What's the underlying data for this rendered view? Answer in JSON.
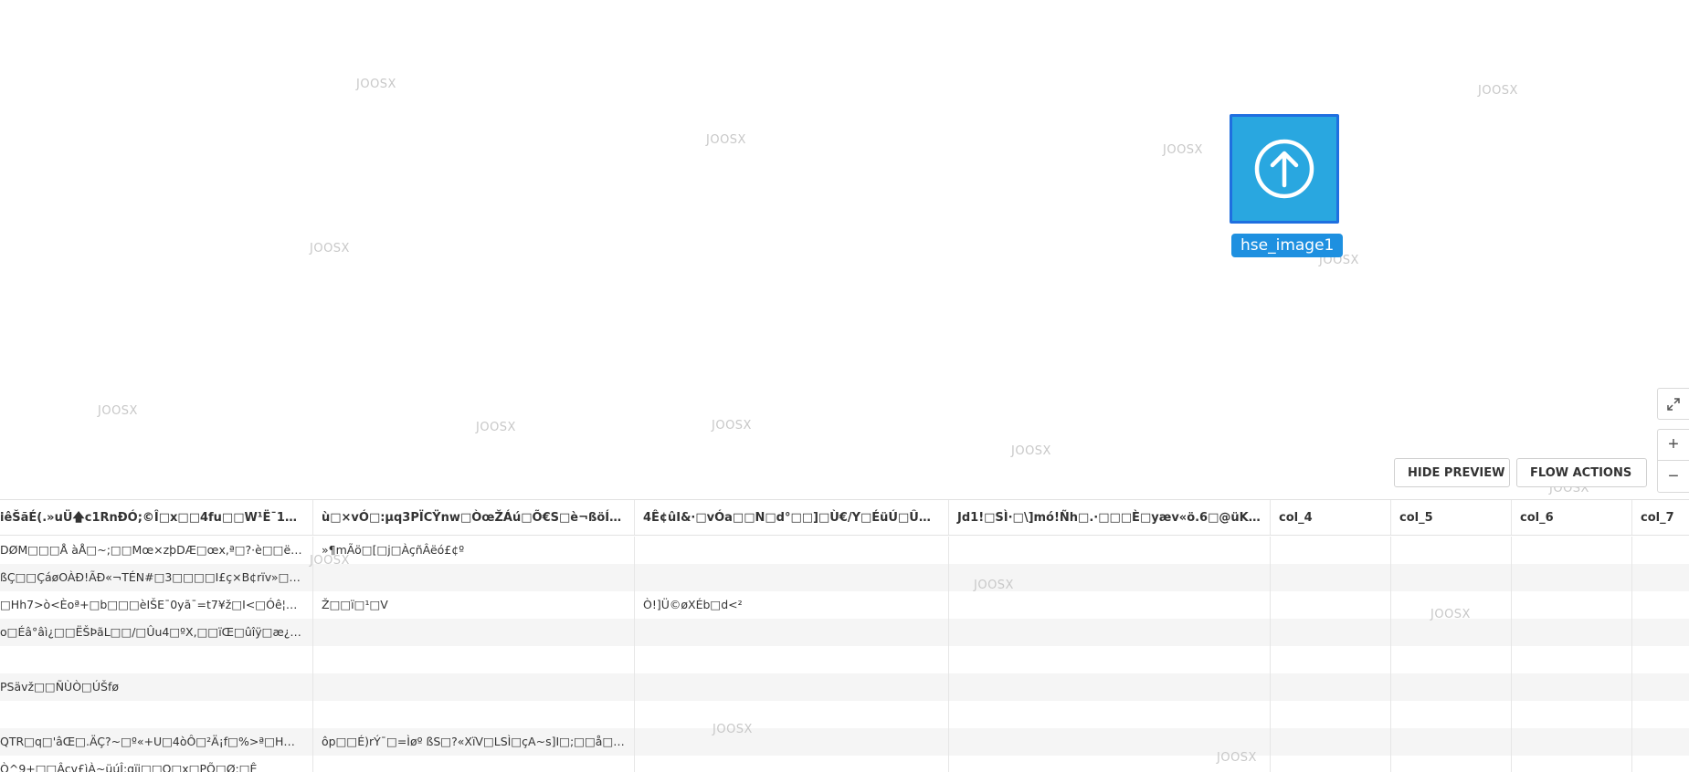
{
  "watermark_text": "JOOSX",
  "node": {
    "icon": "upload-arrow-circle-icon",
    "label": "hse_image1",
    "color": "#29a7e0",
    "border_color": "#1f6fe0"
  },
  "toolbar": {
    "hide_preview_label": "HIDE PREVIEW",
    "flow_actions_label": "FLOW ACTIONS"
  },
  "zoom": {
    "expand_icon": "expand-icon",
    "zoom_in_label": "+",
    "zoom_out_label": "−"
  },
  "table": {
    "columns": [
      "iêŠãÉ(.»uÜ🡅c1RnÐÓ;©Î□x□□4fu□□W¹Ë¯1Ê£;aY...",
      "ù□×vÓ□:µq3PÏCŸnw□ÒœŽÁú□Õ€S□è¬ßöÍ□F□©Ò...",
      "4Ê¢ûI&·□vÓa□□N□d°□□]□Ù€/Y□ÉüÚ□Û□vužD",
      "Jd1!□SÌ·□\\]mó!Ñh□.·□□□È□yæv«ö.6□@üK\\ãÁ□□ï¢...",
      "col_4",
      "col_5",
      "col_6",
      "col_7"
    ],
    "rows": [
      [
        "DØM□□□Å àÅ□~;□□Mœ×zþDÆ□œx,ª□?·è□□ë°vðjÌ□=□ï,",
        "»¶mÃö□[□j□ÀçñÂëó£¢º",
        "",
        "",
        "",
        "",
        "",
        ""
      ],
      [
        "ßÇ□□ÇáøOÀÐ!ÃÐ«¬TÉN#□3□□□□I£ç×B¢rïv»□□0□Ú*...",
        "",
        "",
        "",
        "",
        "",
        "",
        ""
      ],
      [
        "□Hh7>ò<Èoª+□b□□□èIŠE¯0yã¯=t7¥ž□I<□Óê¦□□ËåJÜ...",
        "Ž□□ï□¹□V",
        "Ò!]Ü©øXÉb□d<²",
        "",
        "",
        "",
        "",
        ""
      ],
      [
        "o□Éâ°âì¿□□ËŠÞãL□□/□Ûu4□ºX,□□ïŒ□ûîÿ□æ¿õ.ê÷í□...",
        "",
        "",
        "",
        "",
        "",
        "",
        ""
      ],
      [
        "",
        "",
        "",
        "",
        "",
        "",
        "",
        ""
      ],
      [
        "PSävž□□ÑÙÒ□ÚŠfø",
        "",
        "",
        "",
        "",
        "",
        "",
        ""
      ],
      [
        "",
        "",
        "",
        "",
        "",
        "",
        "",
        ""
      ],
      [
        "QTR□q□'âŒ□.ÄÇ?~□º«+U□4òÔ□²Ä¡f□%>ª□H×/ĺ¢êÞ%...",
        "ôp□□É)rÝ¯□=Ìøº ßS□?«XïV□LSÌ□çA~s]I□;□□å□6Ó¢W□...",
        "",
        "",
        "",
        "",
        "",
        ""
      ],
      [
        "Ò^9+□□Âçv£ìÀ~üúÎ;qïj□□O□x□PÕ□Ø;□Ê",
        "",
        "",
        "",
        "",
        "",
        "",
        ""
      ]
    ]
  }
}
